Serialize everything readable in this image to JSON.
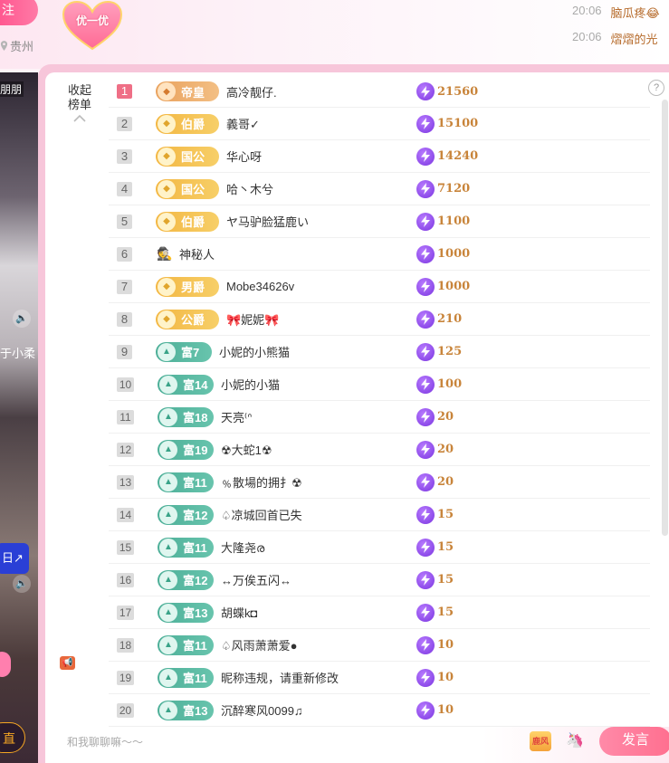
{
  "header": {
    "follow_label": "关注",
    "follow_visible": "注",
    "location": "贵州",
    "badge_label": "优一优",
    "messages": [
      {
        "time": "20:06",
        "text": "脑瓜疼😂"
      },
      {
        "time": "20:06",
        "text": "熠熠的光"
      }
    ]
  },
  "video": {
    "label_top": "朋朋",
    "label_mid": "于小柔",
    "blue_button": "日↗"
  },
  "panel": {
    "collapse_label": "收起\n榜单",
    "help": "?",
    "rows": [
      {
        "rank": "1",
        "badge_type": "emp",
        "badge": "帝皇",
        "name": "高冷靓仔.",
        "score": "21560"
      },
      {
        "rank": "2",
        "badge_type": "gold",
        "badge": "伯爵",
        "name": "義哥✓",
        "score": "15100"
      },
      {
        "rank": "3",
        "badge_type": "gold",
        "badge": "国公",
        "name": "华心呀",
        "score": "14240"
      },
      {
        "rank": "4",
        "badge_type": "gold",
        "badge": "国公",
        "name": "哈丶木兮",
        "score": "7120"
      },
      {
        "rank": "5",
        "badge_type": "gold",
        "badge": "伯爵",
        "name": "ヤ马驴脸猛鹿い",
        "score": "1100"
      },
      {
        "rank": "6",
        "badge_type": "mystery",
        "badge": "",
        "name": "神秘人",
        "score": "1000"
      },
      {
        "rank": "7",
        "badge_type": "gold",
        "badge": "男爵",
        "name": "Mobe34626v",
        "score": "1000"
      },
      {
        "rank": "8",
        "badge_type": "gold",
        "badge": "公爵",
        "name": "🎀妮妮🎀",
        "score": "210"
      },
      {
        "rank": "9",
        "badge_type": "teal",
        "badge": "富7",
        "name": "小妮的小熊猫",
        "score": "125"
      },
      {
        "rank": "10",
        "badge_type": "teal",
        "badge": "富14",
        "name": "小妮的小猫",
        "score": "100"
      },
      {
        "rank": "11",
        "badge_type": "teal",
        "badge": "富18",
        "name": "天亮⁽ᐢ",
        "score": "20"
      },
      {
        "rank": "12",
        "badge_type": "teal",
        "badge": "富19",
        "name": "☢大蛇1☢",
        "score": "20"
      },
      {
        "rank": "13",
        "badge_type": "teal",
        "badge": "富11",
        "name": "﹪散場的拥扌☢",
        "score": "20"
      },
      {
        "rank": "14",
        "badge_type": "teal",
        "badge": "富12",
        "name": "♤凉城回首已失",
        "score": "15"
      },
      {
        "rank": "15",
        "badge_type": "teal",
        "badge": "富11",
        "name": "大隆尧ര",
        "score": "15"
      },
      {
        "rank": "16",
        "badge_type": "teal",
        "badge": "富12",
        "name": "↔万俟五闪↔",
        "score": "15"
      },
      {
        "rank": "17",
        "badge_type": "teal",
        "badge": "富13",
        "name": "胡蝶k◘",
        "score": "15"
      },
      {
        "rank": "18",
        "badge_type": "teal",
        "badge": "富11",
        "name": "♤风雨萧萧爱●",
        "score": "10"
      },
      {
        "rank": "19",
        "badge_type": "teal",
        "badge": "富11",
        "name": "昵称违规，请重新修改",
        "score": "10"
      },
      {
        "rank": "20",
        "badge_type": "teal",
        "badge": "富13",
        "name": "沉醉寒风0099♫",
        "score": "10"
      }
    ]
  },
  "input": {
    "placeholder": "和我聊聊嘛～～",
    "send_label": "发言",
    "emoji_label": "鹿风"
  },
  "colors": {
    "accent_pink": "#ff6f8f",
    "score_gold": "#c8843a",
    "rich_teal": "#4daf98",
    "noble_gold": "#f3b743"
  }
}
